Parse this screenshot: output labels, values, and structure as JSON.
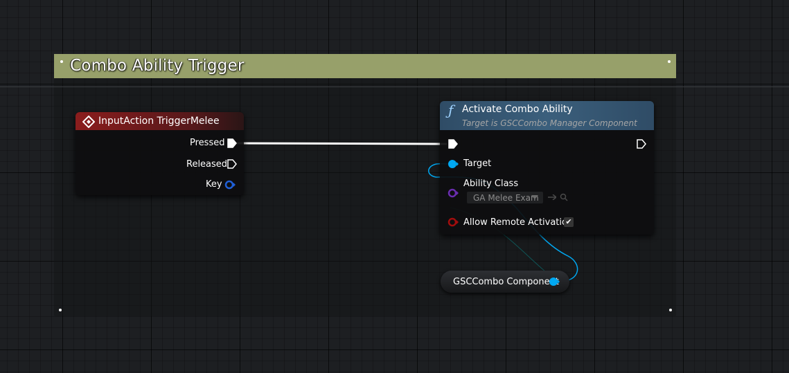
{
  "comment": {
    "title": "Combo Ability Trigger",
    "color": "#97a06a"
  },
  "input_node": {
    "title": "InputAction TriggerMelee",
    "header_color": "#8b1d1d",
    "pins": {
      "pressed": "Pressed",
      "released": "Released",
      "key": "Key"
    }
  },
  "function_node": {
    "title": "Activate Combo Ability",
    "subtitle": "Target is GSCCombo Manager Component",
    "header_color": "#3b5f7c",
    "pins": {
      "target": "Target",
      "ability_class": "Ability Class",
      "ability_class_value": "GA Melee Exam",
      "allow_remote": "Allow Remote Activation",
      "allow_remote_checked": "✔"
    }
  },
  "variable_node": {
    "label": "GSCCombo Component"
  },
  "icons": {
    "event": "input-event-diamond-icon",
    "function": "function-f-icon",
    "exec": "exec-pin-icon",
    "object": "object-pin-icon",
    "class": "class-pin-icon",
    "bool": "bool-pin-icon",
    "browse": "browse-arrow-icon",
    "search": "search-icon"
  },
  "colors": {
    "exec_wire": "#ffffff",
    "object_wire": "#00a8f2",
    "class_pin": "#6a2db0",
    "bool_pin": "#a20d0d",
    "key_pin": "#2060d8"
  }
}
